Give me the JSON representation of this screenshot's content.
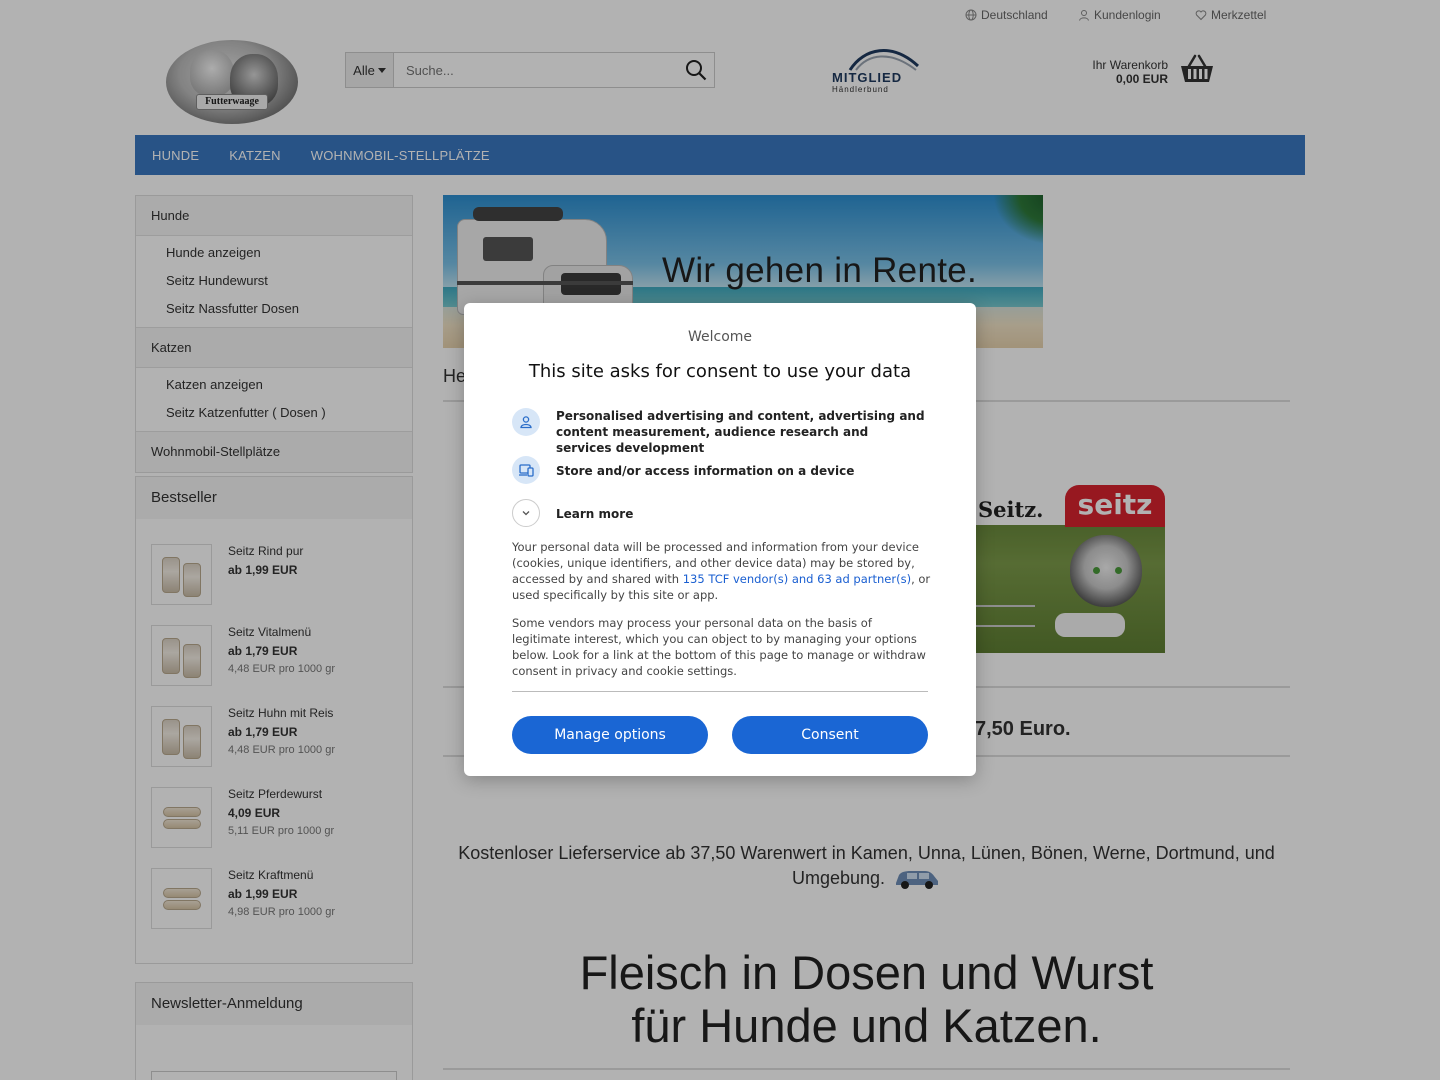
{
  "topbar": {
    "country": "Deutschland",
    "login": "Kundenlogin",
    "wishlist": "Merkzettel"
  },
  "logo": {
    "text": "Futterwaage"
  },
  "search": {
    "category": "Alle",
    "placeholder": "Suche...",
    "value": ""
  },
  "member_badge": {
    "title": "MITGLIED",
    "subtitle": "Händlerbund"
  },
  "cart": {
    "label": "Ihr Warenkorb",
    "value": "0,00 EUR"
  },
  "nav": {
    "items": [
      "HUNDE",
      "KATZEN",
      "WOHNMOBIL-STELLPLÄTZE"
    ]
  },
  "categories": [
    {
      "label": "Hunde",
      "children": [
        "Hunde anzeigen",
        "Seitz Hundewurst",
        "Seitz Nassfutter Dosen"
      ]
    },
    {
      "label": "Katzen",
      "children": [
        "Katzen anzeigen",
        "Seitz Katzenfutter ( Dosen )"
      ]
    },
    {
      "label": "Wohnmobil-Stellplätze",
      "children": []
    }
  ],
  "bestseller": {
    "title": "Bestseller",
    "items": [
      {
        "name": "Seitz Rind pur",
        "price": "ab 1,99 EUR",
        "unit": "",
        "thumb": "cans"
      },
      {
        "name": "Seitz Vitalmenü",
        "price": "ab 1,79 EUR",
        "unit": "4,48 EUR pro 1000 gr",
        "thumb": "cans"
      },
      {
        "name": "Seitz Huhn mit Reis",
        "price": "ab 1,79 EUR",
        "unit": "4,48 EUR pro 1000 gr",
        "thumb": "cans"
      },
      {
        "name": "Seitz Pferdewurst",
        "price": "4,09 EUR",
        "unit": "5,11 EUR pro 1000 gr",
        "thumb": "sausages"
      },
      {
        "name": "Seitz Kraftmenü",
        "price": "ab 1,99 EUR",
        "unit": "4,98 EUR pro 1000 gr",
        "thumb": "sausages"
      }
    ]
  },
  "newsletter": {
    "title": "Newsletter-Anmeldung"
  },
  "main": {
    "hero_text": "Wir gehen in Rente.",
    "welcome_partial": "He",
    "seitz_logo_text": "Seitz.",
    "seitz_badge": "seitz",
    "euro_partial": "7,50 Euro.",
    "delivery_text": "Kostenloser Lieferservice ab 37,50 Warenwert in Kamen, Unna, Lünen, Bönen, Werne, Dortmund, und Umgebung.",
    "headline_line1": "Fleisch in Dosen und Wurst",
    "headline_line2": "für Hunde und Katzen."
  },
  "consent": {
    "welcome": "Welcome",
    "title": "This site asks for consent to use your data",
    "purposes": [
      {
        "icon": "person-icon",
        "text": "Personalised advertising and content, advertising and content measurement, audience research and services development"
      },
      {
        "icon": "device-icon",
        "text": "Store and/or access information on a device"
      }
    ],
    "learn_more": "Learn more",
    "para1_before": "Your personal data will be processed and information from your device (cookies, unique identifiers, and other device data) may be stored by, accessed by and shared with ",
    "para1_link": "135 TCF vendor(s) and 63 ad partner(s)",
    "para1_after": ", or used specifically by this site or app.",
    "para2": "Some vendors may process your personal data on the basis of legitimate interest, which you can object to by managing your options below. Look for a link at the bottom of this page to manage or withdraw consent in privacy and cookie settings.",
    "manage_button": "Manage options",
    "consent_button": "Consent",
    "accent_color": "#1a66d4"
  },
  "colors": {
    "nav": "#3a77c0",
    "seitz_red": "#d8232f"
  }
}
